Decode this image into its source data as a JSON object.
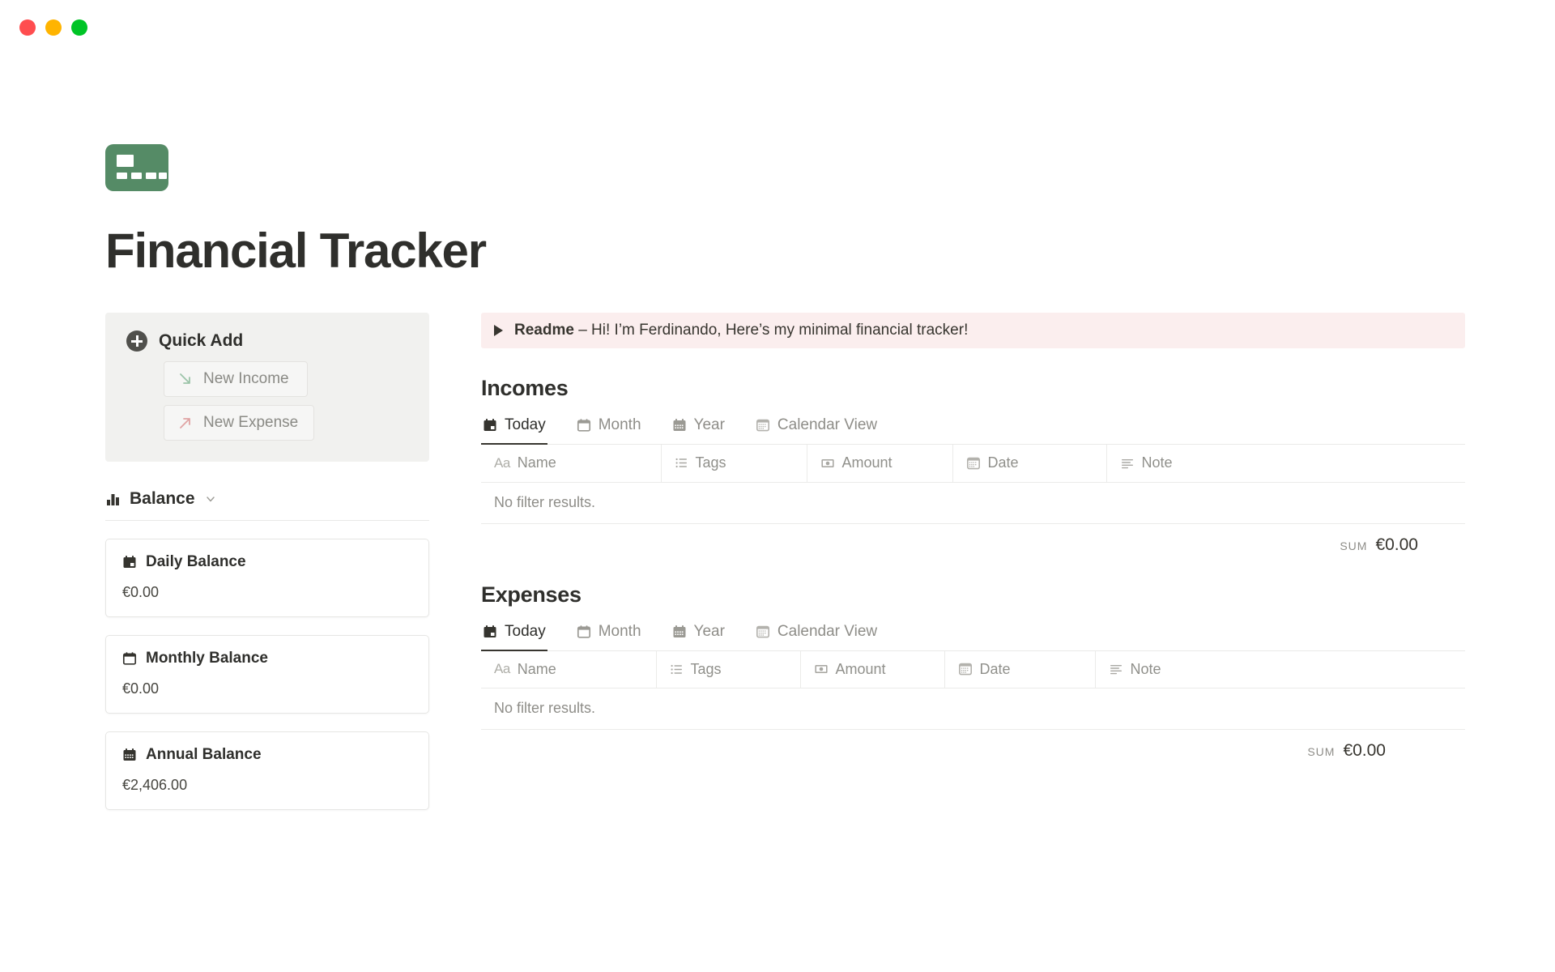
{
  "window": {
    "buttons": [
      {
        "name": "close",
        "color": "#ff4d4f"
      },
      {
        "name": "minimize",
        "color": "#ffb400"
      },
      {
        "name": "maximize",
        "color": "#00c426"
      }
    ]
  },
  "page": {
    "icon": "credit-card-icon",
    "icon_color": "#558b66",
    "title": "Financial Tracker"
  },
  "quick_add": {
    "heading": "Quick Add",
    "plus_icon": "plus-circle-icon",
    "buttons": [
      {
        "label": "New Income",
        "icon": "arrow-down-right-icon",
        "color": "#8fbd9f"
      },
      {
        "label": "New Expense",
        "icon": "arrow-up-right-icon",
        "color": "#e3a4a4"
      }
    ]
  },
  "balance": {
    "heading": "Balance",
    "heading_icon": "bar-chart-icon",
    "chevron": "chevron-down-icon",
    "cards": [
      {
        "title": "Daily Balance",
        "icon": "calendar-today-icon",
        "value": "€0.00"
      },
      {
        "title": "Monthly Balance",
        "icon": "calendar-month-icon",
        "value": "€0.00"
      },
      {
        "title": "Annual Balance",
        "icon": "calendar-year-icon",
        "value": "€2,406.00"
      }
    ]
  },
  "readme": {
    "toggle_icon": "triangle-right-icon",
    "bold_label": "Readme",
    "text": " – Hi! I’m Ferdinando, Here’s my minimal financial tracker!"
  },
  "incomes": {
    "title": "Incomes",
    "tabs": [
      {
        "label": "Today",
        "icon": "calendar-today-icon",
        "active": true
      },
      {
        "label": "Month",
        "icon": "calendar-month-icon",
        "active": false
      },
      {
        "label": "Year",
        "icon": "calendar-year-icon",
        "active": false
      },
      {
        "label": "Calendar View",
        "icon": "calendar-view-icon",
        "active": false
      }
    ],
    "columns": [
      {
        "label": "Name",
        "icon": "text-aa-icon"
      },
      {
        "label": "Tags",
        "icon": "list-icon"
      },
      {
        "label": "Amount",
        "icon": "banknote-icon"
      },
      {
        "label": "Date",
        "icon": "calendar-view-icon"
      },
      {
        "label": "Note",
        "icon": "text-lines-icon"
      }
    ],
    "empty_message": "No filter results.",
    "sum_label": "SUM",
    "sum_value": "€0.00"
  },
  "expenses": {
    "title": "Expenses",
    "tabs": [
      {
        "label": "Today",
        "icon": "calendar-today-icon",
        "active": true
      },
      {
        "label": "Month",
        "icon": "calendar-month-icon",
        "active": false
      },
      {
        "label": "Year",
        "icon": "calendar-year-icon",
        "active": false
      },
      {
        "label": "Calendar View",
        "icon": "calendar-view-icon",
        "active": false
      }
    ],
    "columns": [
      {
        "label": "Name",
        "icon": "text-aa-icon"
      },
      {
        "label": "Tags",
        "icon": "list-icon"
      },
      {
        "label": "Amount",
        "icon": "banknote-icon"
      },
      {
        "label": "Date",
        "icon": "calendar-view-icon"
      },
      {
        "label": "Note",
        "icon": "text-lines-icon"
      }
    ],
    "empty_message": "No filter results.",
    "sum_label": "SUM",
    "sum_value": "€0.00"
  }
}
